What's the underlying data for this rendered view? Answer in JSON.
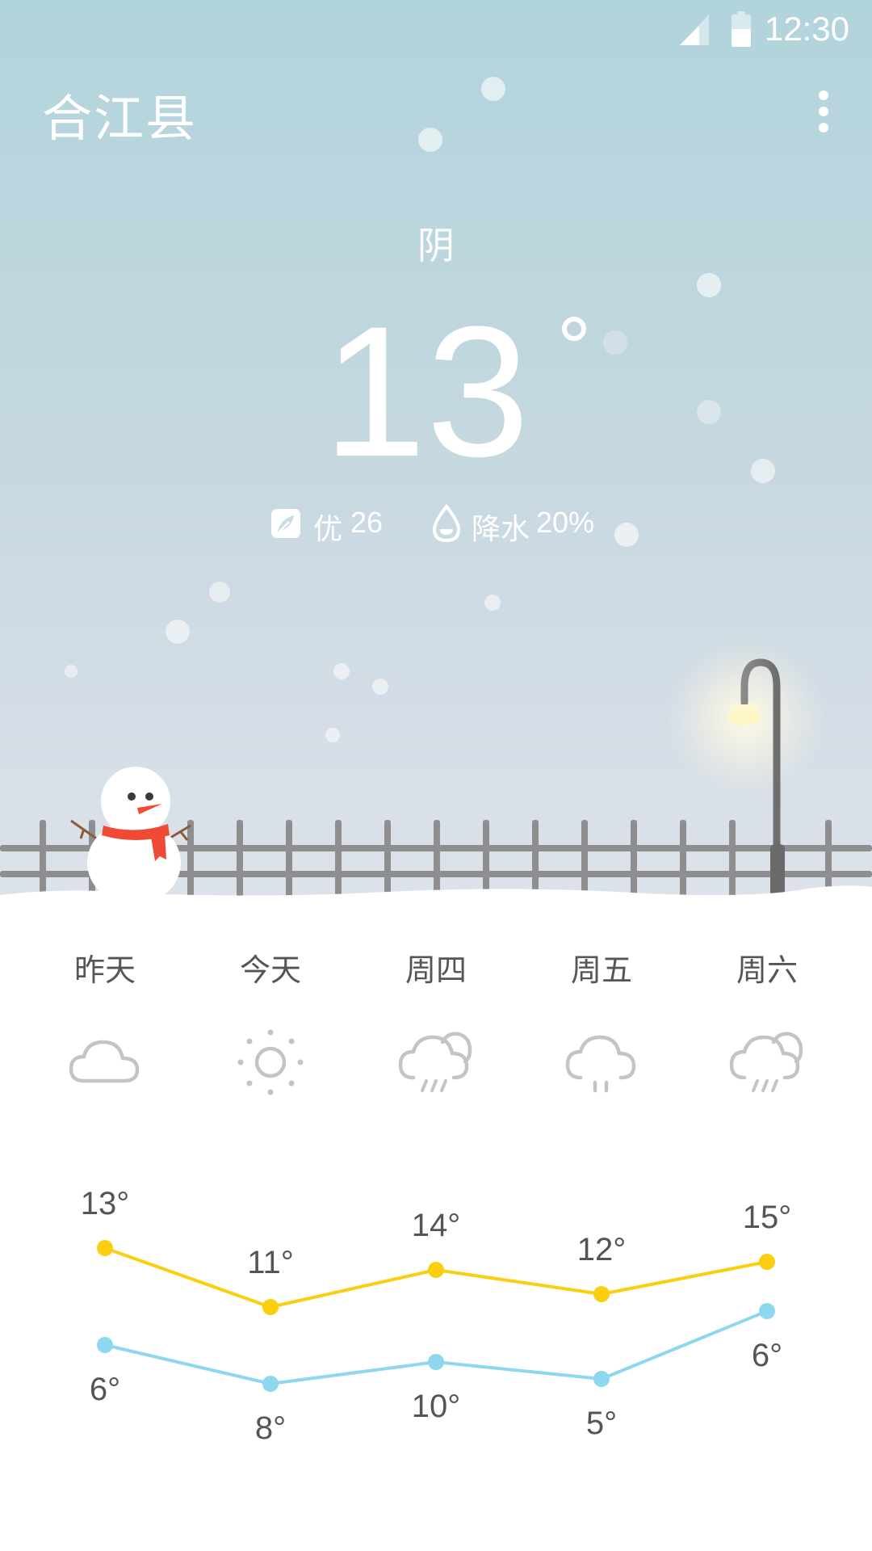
{
  "status_bar": {
    "time": "12:30"
  },
  "header": {
    "city": "合江县"
  },
  "current": {
    "condition": "阴",
    "temperature": "13",
    "aqi_label": "优",
    "aqi_value": "26",
    "precip_label": "降水",
    "precip_value": "20%"
  },
  "forecast": {
    "days": [
      {
        "label": "昨天",
        "icon": "cloud-icon",
        "high": 13,
        "low": 6
      },
      {
        "label": "今天",
        "icon": "sun-icon",
        "high": 11,
        "low": 8
      },
      {
        "label": "周四",
        "icon": "rain-cloud-icon",
        "high": 14,
        "low": 10
      },
      {
        "label": "周五",
        "icon": "drizzle-icon",
        "high": 12,
        "low": 5
      },
      {
        "label": "周六",
        "icon": "rain-cloud-icon",
        "high": 15,
        "low": 6
      }
    ]
  },
  "chart_data": {
    "type": "line",
    "categories": [
      "昨天",
      "今天",
      "周四",
      "周五",
      "周六"
    ],
    "series": [
      {
        "values": [
          13,
          11,
          14,
          12,
          15
        ],
        "color": "#f9cf0f"
      },
      {
        "values": [
          6,
          8,
          10,
          5,
          6
        ],
        "color": "#8dd8ee"
      }
    ],
    "unit": "°"
  },
  "colors": {
    "high_line": "#f9cf0f",
    "low_line": "#8dd8ee",
    "label_text": "#555555",
    "icon_gray": "#c4c4c4",
    "scarf": "#f04a34"
  }
}
